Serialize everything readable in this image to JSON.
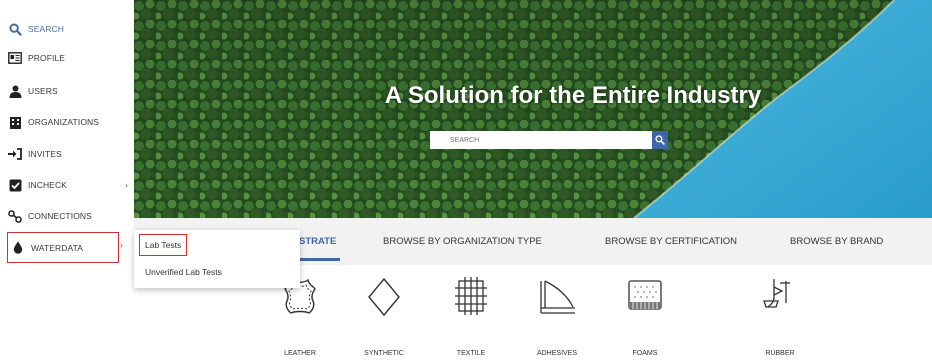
{
  "sidebar": {
    "items": [
      {
        "label": "SEARCH",
        "icon": "search-icon"
      },
      {
        "label": "PROFILE",
        "icon": "id-card-icon"
      },
      {
        "label": "USERS",
        "icon": "user-icon"
      },
      {
        "label": "ORGANIZATIONS",
        "icon": "building-icon"
      },
      {
        "label": "INVITES",
        "icon": "sign-in-icon"
      },
      {
        "label": "INCHECK",
        "icon": "checkbox-icon"
      },
      {
        "label": "CONNECTIONS",
        "icon": "connections-icon"
      },
      {
        "label": "WATERDATA",
        "icon": "water-drop-icon"
      }
    ]
  },
  "hero": {
    "title": "A Solution for the Entire Industry",
    "search_placeholder": "SEARCH"
  },
  "tabs": {
    "items": [
      {
        "label": "STRATE"
      },
      {
        "label": "BROWSE BY ORGANIZATION TYPE"
      },
      {
        "label": "BROWSE BY CERTIFICATION"
      },
      {
        "label": "BROWSE BY BRAND"
      }
    ],
    "active_index": 0
  },
  "dropdown": {
    "items": [
      {
        "label": "Lab Tests"
      },
      {
        "label": "Unverified Lab Tests"
      }
    ]
  },
  "categories": [
    {
      "label": "LEATHER",
      "icon": "leather-hide-icon"
    },
    {
      "label": "SYNTHETIC",
      "icon": "diamond-icon"
    },
    {
      "label": "TEXTILE",
      "icon": "textile-weave-icon"
    },
    {
      "label": "ADHESIVES",
      "icon": "adhesive-layers-icon"
    },
    {
      "label": "FOAMS",
      "icon": "foam-block-icon"
    },
    {
      "label": "RUBBER",
      "icon": "rubber-tap-icon"
    }
  ],
  "colors": {
    "accent": "#3e66a8",
    "highlight_box": "#d32f2f",
    "tab_bar_bg": "#f2f2f2",
    "lake": "#3aa9d6",
    "forest": "#2e5f2a"
  }
}
